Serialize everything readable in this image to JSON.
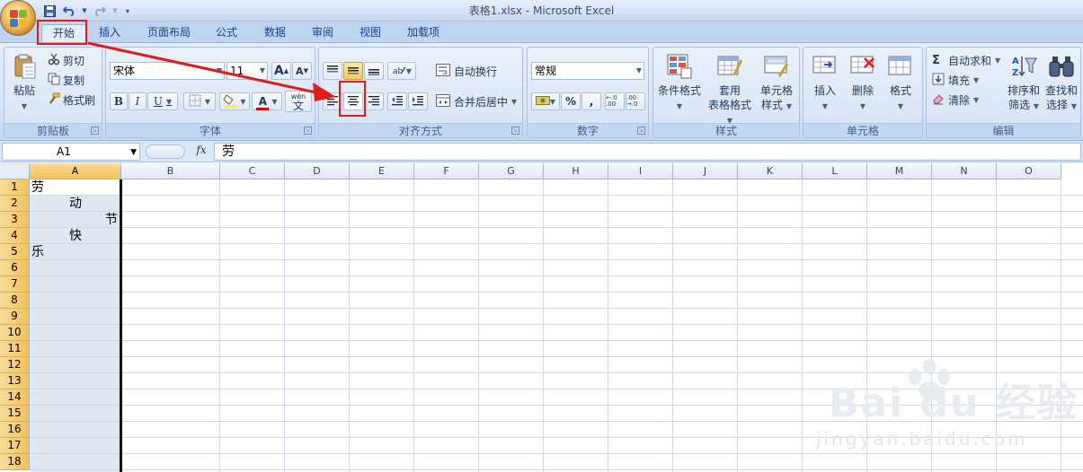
{
  "window": {
    "title": "表格1.xlsx - Microsoft Excel"
  },
  "quick_access": [
    "save-icon",
    "undo-icon",
    "redo-icon",
    "customize-icon"
  ],
  "tabs": [
    "开始",
    "插入",
    "页面布局",
    "公式",
    "数据",
    "审阅",
    "视图",
    "加载项"
  ],
  "active_tab": "开始",
  "ribbon": {
    "clipboard": {
      "label": "剪贴板",
      "paste": "粘贴",
      "cut": "剪切",
      "copy": "复制",
      "format_painter": "格式刷"
    },
    "font": {
      "label": "字体",
      "font_name": "宋体",
      "font_size": "11",
      "grow": "A",
      "shrink": "A",
      "bold": "B",
      "italic": "I",
      "underline": "U",
      "font_color_letter": "A",
      "phonetic_top": "wén",
      "phonetic_char": "文"
    },
    "alignment": {
      "label": "对齐方式",
      "wrap_text": "自动换行",
      "merge_center": "合并后居中"
    },
    "number": {
      "label": "数字",
      "format": "常规",
      "percent": "%",
      "comma": ",",
      "inc_decimal": "←.0 .00",
      "dec_decimal": ".00 →.0"
    },
    "styles": {
      "label": "样式",
      "conditional_1": "条件格式",
      "table_1": "套用",
      "table_2": "表格格式",
      "cell_1": "单元格",
      "cell_2": "样式"
    },
    "cells": {
      "label": "单元格",
      "insert": "插入",
      "delete": "删除",
      "format": "格式"
    },
    "editing": {
      "label": "编辑",
      "autosum": "自动求和",
      "fill": "填充",
      "clear": "清除",
      "sort_1": "排序和",
      "sort_2": "筛选",
      "find_1": "查找和",
      "find_2": "选择"
    }
  },
  "formula_bar": {
    "name_box": "A1",
    "fx": "fx",
    "content": "劳"
  },
  "grid": {
    "columns": [
      "A",
      "B",
      "C",
      "D",
      "E",
      "F",
      "G",
      "H",
      "I",
      "J",
      "K",
      "L",
      "M",
      "N",
      "O"
    ],
    "rows": [
      "1",
      "2",
      "3",
      "4",
      "5",
      "6",
      "7",
      "8",
      "9",
      "10",
      "11",
      "12",
      "13",
      "14",
      "15",
      "16",
      "17",
      "18"
    ],
    "selected_column": "A",
    "cells": {
      "A1": "劳",
      "A2": "动",
      "A3": "节",
      "A4": "快",
      "A5": "乐"
    }
  },
  "watermark": {
    "brand": "Bai du 经验",
    "url": "jingyan.baidu.com"
  },
  "colors": {
    "highlight_red": "#e11a1a",
    "ribbon_blue": "#d6e4f5",
    "selection_gold": "#f1c15f"
  }
}
